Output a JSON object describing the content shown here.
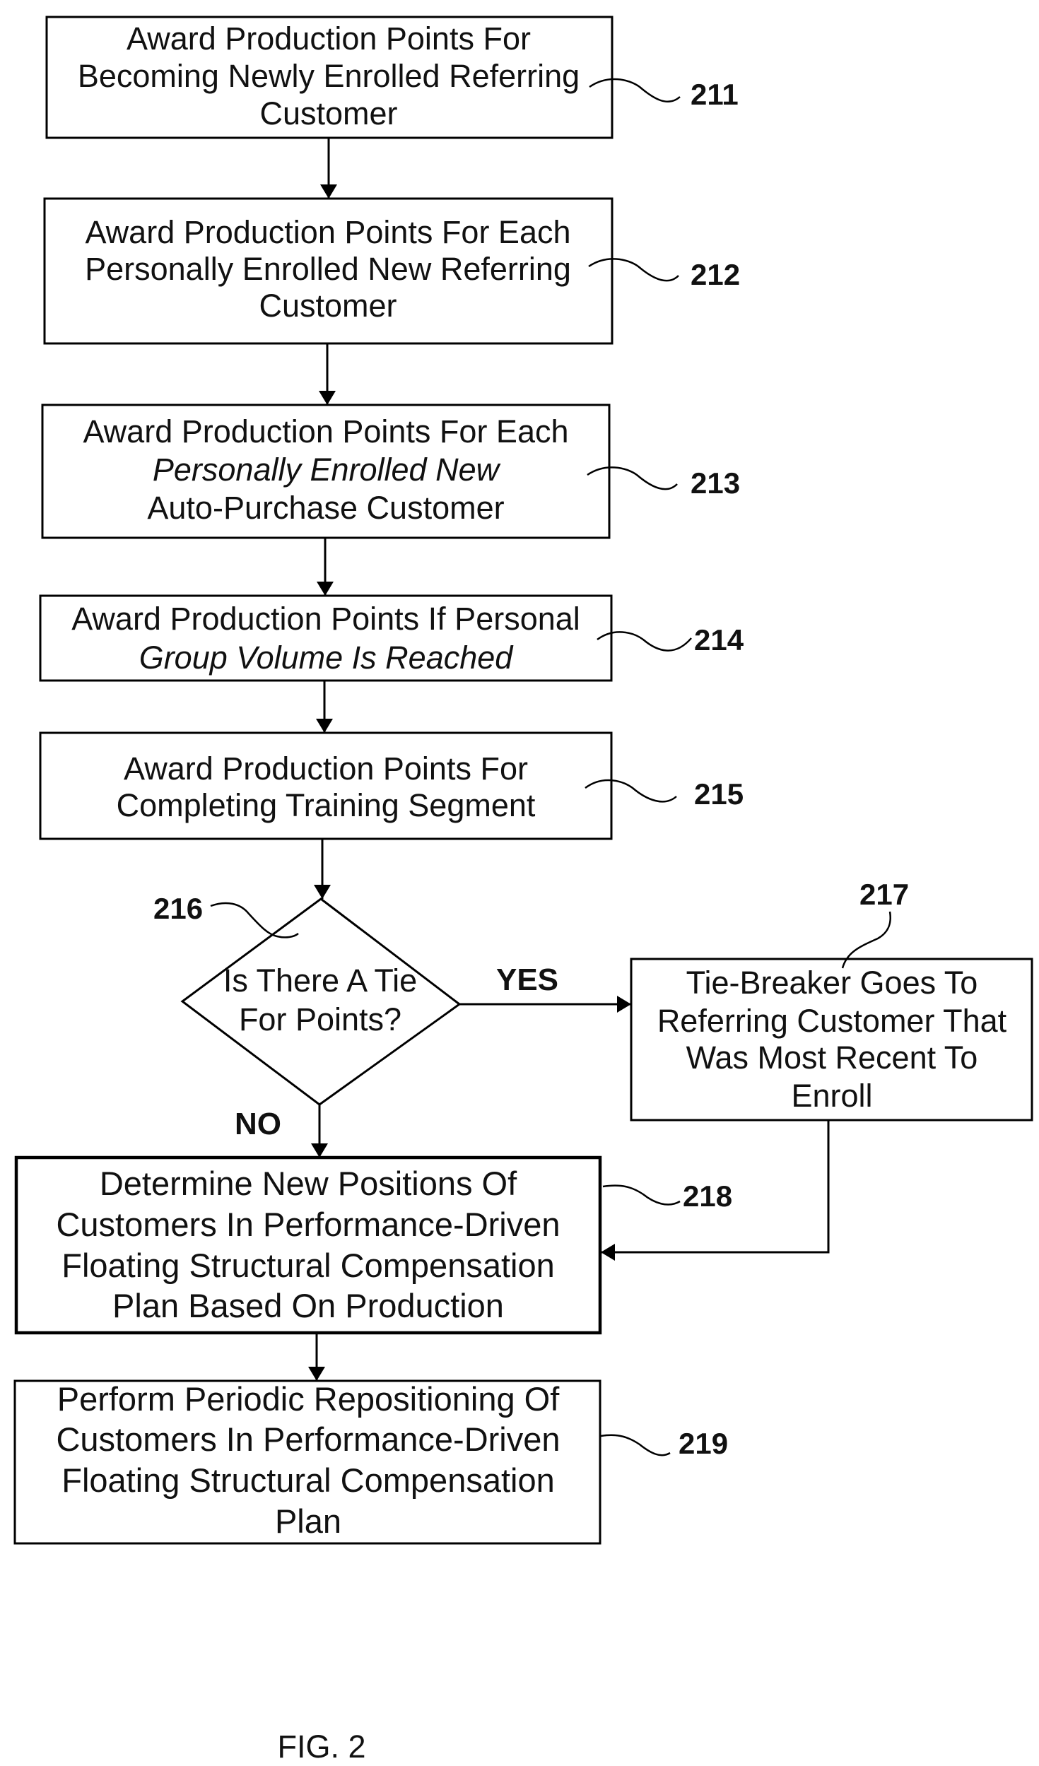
{
  "figure": {
    "caption": "FIG. 2"
  },
  "steps": [
    {
      "ref": "211",
      "lines": [
        "Award Production Points For",
        "Becoming Newly Enrolled Referring",
        "Customer"
      ]
    },
    {
      "ref": "212",
      "lines": [
        "Award Production Points For Each",
        "Personally Enrolled New Referring",
        "Customer"
      ]
    },
    {
      "ref": "213",
      "lines": [
        "Award Production Points For Each",
        "Personally Enrolled New",
        "Auto-Purchase Customer"
      ]
    },
    {
      "ref": "214",
      "lines": [
        "Award Production Points If Personal",
        "Group Volume Is Reached"
      ]
    },
    {
      "ref": "215",
      "lines": [
        "Award Production Points For",
        "Completing Training Segment"
      ]
    }
  ],
  "decision": {
    "ref": "216",
    "lines": [
      "Is There A Tie",
      "For Points?"
    ],
    "yes_label": "YES",
    "no_label": "NO"
  },
  "tiebreaker": {
    "ref": "217",
    "lines": [
      "Tie-Breaker Goes To",
      "Referring Customer That",
      "Was Most Recent To",
      "Enroll"
    ]
  },
  "determine": {
    "ref": "218",
    "lines": [
      "Determine New Positions Of",
      "Customers In Performance-Driven",
      "Floating Structural Compensation",
      "Plan Based On Production"
    ]
  },
  "reposition": {
    "ref": "219",
    "lines": [
      "Perform Periodic Repositioning Of",
      "Customers In Performance-Driven",
      "Floating Structural Compensation",
      "Plan"
    ]
  }
}
